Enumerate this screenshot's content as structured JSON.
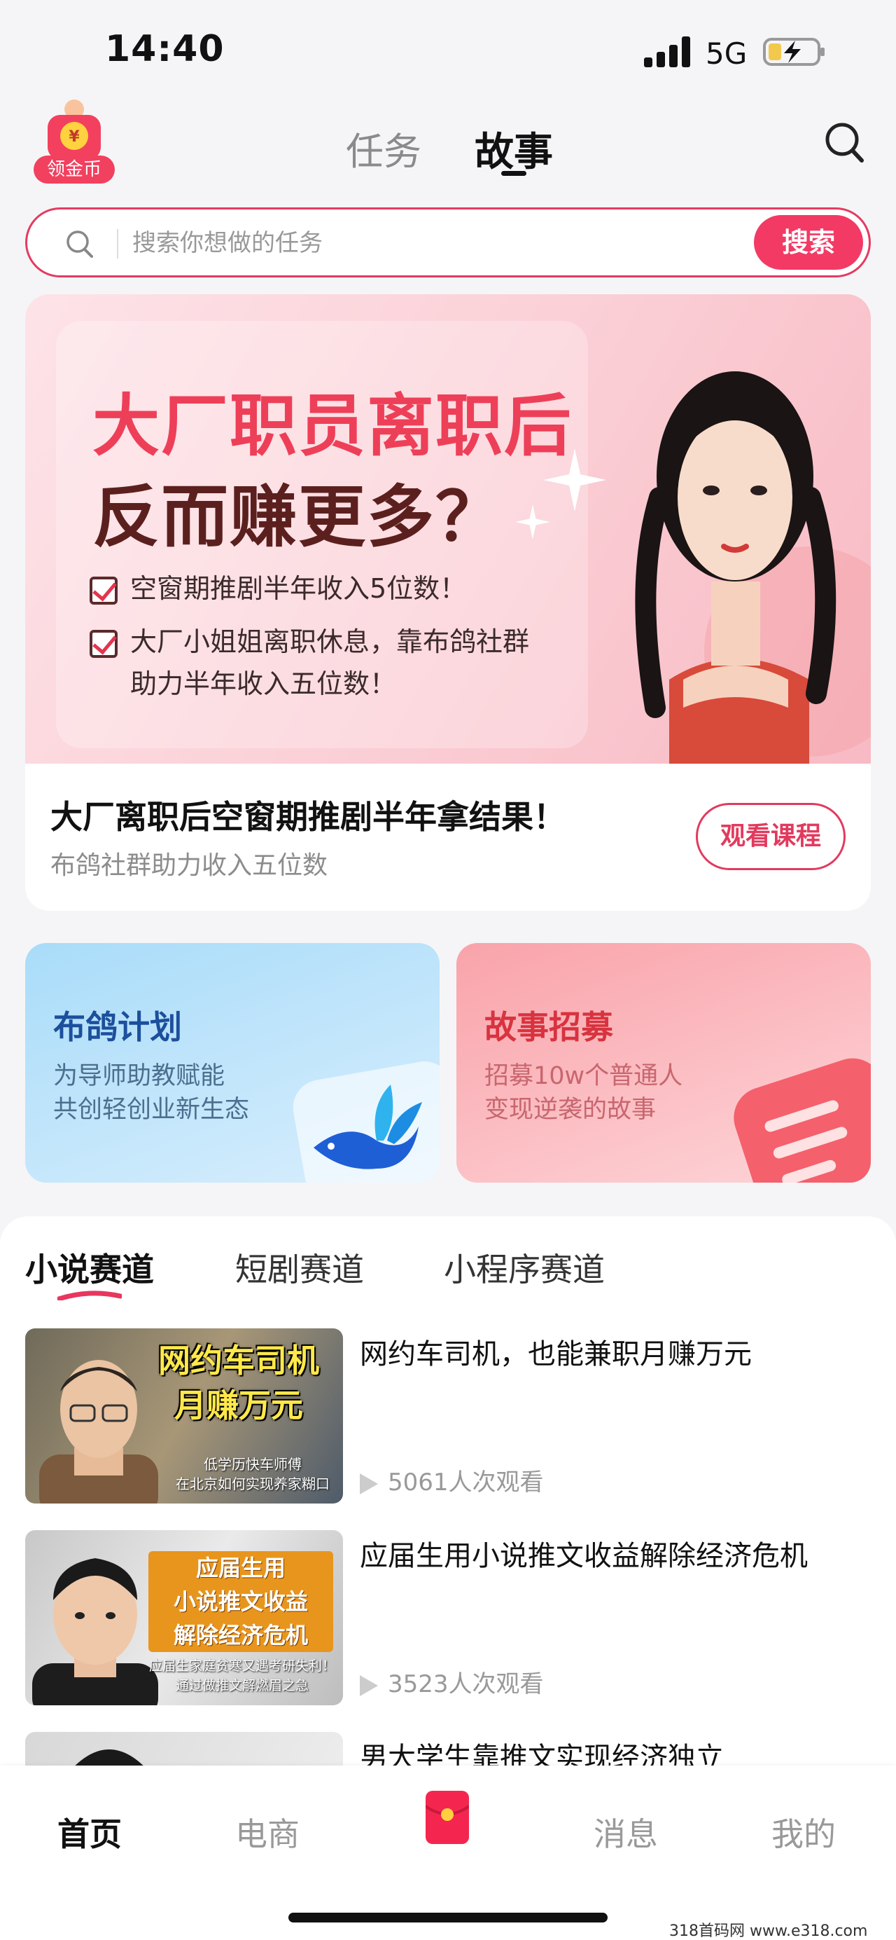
{
  "status_bar": {
    "time": "14:40",
    "network": "5G"
  },
  "header": {
    "gold_badge_label": "领金币",
    "tabs": [
      {
        "label": "任务"
      },
      {
        "label": "故事"
      }
    ],
    "active_tab": "故事"
  },
  "search": {
    "placeholder": "搜索你想做的任务",
    "button_label": "搜索"
  },
  "banner": {
    "headline_line1": "大厂职员离职后",
    "headline_line2": "反而赚更多？",
    "bullets": [
      {
        "lines": [
          "空窗期推剧半年收入5位数！"
        ]
      },
      {
        "lines": [
          "大厂小姐姐离职休息，靠布鸽社群",
          "助力半年收入五位数！"
        ]
      }
    ],
    "caption": "大厂离职后空窗期推剧半年拿结果！",
    "subcaption": "布鸽社群助力收入五位数",
    "watch_button": "观看课程"
  },
  "cards": [
    {
      "title": "布鸽计划",
      "desc_line1": "为导师助教赋能",
      "desc_line2": "共创轻创业新生态"
    },
    {
      "title": "故事招募",
      "desc_line1": "招募10w个普通人",
      "desc_line2": "变现逆袭的故事"
    }
  ],
  "list_tabs": [
    {
      "label": "小说赛道"
    },
    {
      "label": "短剧赛道"
    },
    {
      "label": "小程序赛道"
    }
  ],
  "active_list_tab": "小说赛道",
  "stories": [
    {
      "title": "网约车司机，也能兼职月赚万元",
      "views": "5061人次观看",
      "thumb_head_1": "网约车司机",
      "thumb_head_2": "月赚万元",
      "thumb_sub_1": "低学历快车师傅",
      "thumb_sub_2": "在北京如何实现养家糊口"
    },
    {
      "title": "应届生用小说推文收益解除经济危机",
      "views": "3523人次观看",
      "thumb_head_1": "应届生用",
      "thumb_head_2": "小说推文收益",
      "thumb_head_3": "解除经济危机",
      "thumb_sub_1": "应届生家庭贫寒又遇考研失利！",
      "thumb_sub_2": "通过做推文解燃眉之急"
    },
    {
      "title": "男大学生靠推文实现经济独立"
    }
  ],
  "bottom_nav": [
    {
      "label": "首页"
    },
    {
      "label": "电商"
    },
    {
      "label": ""
    },
    {
      "label": "消息"
    },
    {
      "label": "我的"
    }
  ],
  "watermark": "318首码网   www.e318.com",
  "colors": {
    "brand_red": "#f23a65",
    "blue_card_title": "#1c4f9c",
    "red_card_title": "#d8333f"
  },
  "icons": [
    "signal-icon",
    "battery-charging-icon",
    "search-icon",
    "bird-logo-icon",
    "document-icon",
    "play-icon",
    "red-packet-icon"
  ]
}
